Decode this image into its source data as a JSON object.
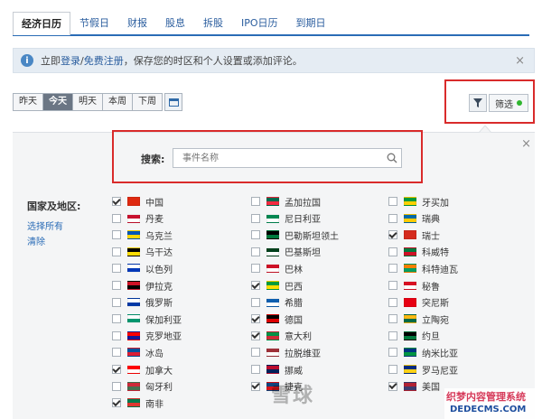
{
  "tabs": [
    "经济日历",
    "节假日",
    "财报",
    "股息",
    "拆股",
    "IPO日历",
    "到期日"
  ],
  "info": {
    "icon": "info-icon",
    "prefix": "立即",
    "login": "登录",
    "sep": "/",
    "register": "免费注册",
    "suffix": "，保存您的时区和个人设置或添加评论。",
    "close": "×"
  },
  "dates": [
    "昨天",
    "今天",
    "明天",
    "本周",
    "下周"
  ],
  "filter": {
    "label": "筛选",
    "status_color": "#2fb52f"
  },
  "panel": {
    "close": "×"
  },
  "search": {
    "label": "搜索:",
    "placeholder": "事件名称"
  },
  "region": {
    "label": "国家及地区:",
    "select_all": "选择所有",
    "clear": "清除"
  },
  "countries": [
    [
      {
        "name": "中国",
        "checked": true,
        "colors": [
          "#de2910",
          "#de2910"
        ]
      },
      {
        "name": "丹麦",
        "checked": false,
        "colors": [
          "#c8102e",
          "#ffffff"
        ]
      },
      {
        "name": "乌克兰",
        "checked": false,
        "colors": [
          "#0057b7",
          "#ffd700"
        ]
      },
      {
        "name": "乌干达",
        "checked": false,
        "colors": [
          "#000000",
          "#fcdc04"
        ]
      },
      {
        "name": "以色列",
        "checked": false,
        "colors": [
          "#ffffff",
          "#0038b8"
        ]
      },
      {
        "name": "伊拉克",
        "checked": false,
        "colors": [
          "#ce1126",
          "#000000"
        ]
      },
      {
        "name": "俄罗斯",
        "checked": false,
        "colors": [
          "#ffffff",
          "#0039a6"
        ]
      },
      {
        "name": "保加利亚",
        "checked": false,
        "colors": [
          "#ffffff",
          "#00966e"
        ]
      },
      {
        "name": "克罗地亚",
        "checked": false,
        "colors": [
          "#ff0000",
          "#171796"
        ]
      },
      {
        "name": "冰岛",
        "checked": false,
        "colors": [
          "#02529c",
          "#dc1e35"
        ]
      },
      {
        "name": "加拿大",
        "checked": true,
        "colors": [
          "#ff0000",
          "#ffffff"
        ]
      },
      {
        "name": "匈牙利",
        "checked": false,
        "colors": [
          "#ce2939",
          "#477050"
        ]
      },
      {
        "name": "南非",
        "checked": true,
        "colors": [
          "#007a4d",
          "#de3831"
        ]
      }
    ],
    [
      {
        "name": "孟加拉国",
        "checked": false,
        "colors": [
          "#006a4e",
          "#f42a41"
        ]
      },
      {
        "name": "尼日利亚",
        "checked": false,
        "colors": [
          "#008751",
          "#ffffff"
        ]
      },
      {
        "name": "巴勒斯坦领土",
        "checked": false,
        "colors": [
          "#000000",
          "#007a3d"
        ]
      },
      {
        "name": "巴基斯坦",
        "checked": false,
        "colors": [
          "#01411c",
          "#ffffff"
        ]
      },
      {
        "name": "巴林",
        "checked": false,
        "colors": [
          "#ce1126",
          "#ffffff"
        ]
      },
      {
        "name": "巴西",
        "checked": true,
        "colors": [
          "#009c3b",
          "#ffdf00"
        ]
      },
      {
        "name": "希腊",
        "checked": false,
        "colors": [
          "#0d5eaf",
          "#ffffff"
        ]
      },
      {
        "name": "德国",
        "checked": true,
        "colors": [
          "#000000",
          "#dd0000"
        ]
      },
      {
        "name": "意大利",
        "checked": true,
        "colors": [
          "#009246",
          "#ce2b37"
        ]
      },
      {
        "name": "拉脱维亚",
        "checked": false,
        "colors": [
          "#9e3039",
          "#ffffff"
        ]
      },
      {
        "name": "挪威",
        "checked": false,
        "colors": [
          "#ba0c2f",
          "#00205b"
        ]
      },
      {
        "name": "捷克",
        "checked": true,
        "colors": [
          "#11457e",
          "#d7141a"
        ]
      }
    ],
    [
      {
        "name": "牙买加",
        "checked": false,
        "colors": [
          "#009b3a",
          "#fed100"
        ]
      },
      {
        "name": "瑞典",
        "checked": false,
        "colors": [
          "#006aa7",
          "#fecc00"
        ]
      },
      {
        "name": "瑞士",
        "checked": true,
        "colors": [
          "#d52b1e",
          "#d52b1e"
        ]
      },
      {
        "name": "科威特",
        "checked": false,
        "colors": [
          "#007a3d",
          "#ce1126"
        ]
      },
      {
        "name": "科特迪瓦",
        "checked": false,
        "colors": [
          "#f77f00",
          "#009e60"
        ]
      },
      {
        "name": "秘鲁",
        "checked": false,
        "colors": [
          "#d91023",
          "#ffffff"
        ]
      },
      {
        "name": "突尼斯",
        "checked": false,
        "colors": [
          "#e70013",
          "#e70013"
        ]
      },
      {
        "name": "立陶宛",
        "checked": false,
        "colors": [
          "#fdb913",
          "#006a44"
        ]
      },
      {
        "name": "约旦",
        "checked": false,
        "colors": [
          "#000000",
          "#007a3d"
        ]
      },
      {
        "name": "纳米比亚",
        "checked": false,
        "colors": [
          "#003580",
          "#009543"
        ]
      },
      {
        "name": "罗马尼亚",
        "checked": false,
        "colors": [
          "#002b7f",
          "#fcd116"
        ]
      },
      {
        "name": "美国",
        "checked": true,
        "colors": [
          "#b22234",
          "#3c3b6e"
        ]
      }
    ]
  ],
  "watermark": {
    "text": "雪球",
    "site_a": "织梦内容管理系统",
    "site_b": "DEDECMS.COM"
  },
  "colors": {
    "accent": "#2a6cb6",
    "highlight": "#d92b2b"
  }
}
